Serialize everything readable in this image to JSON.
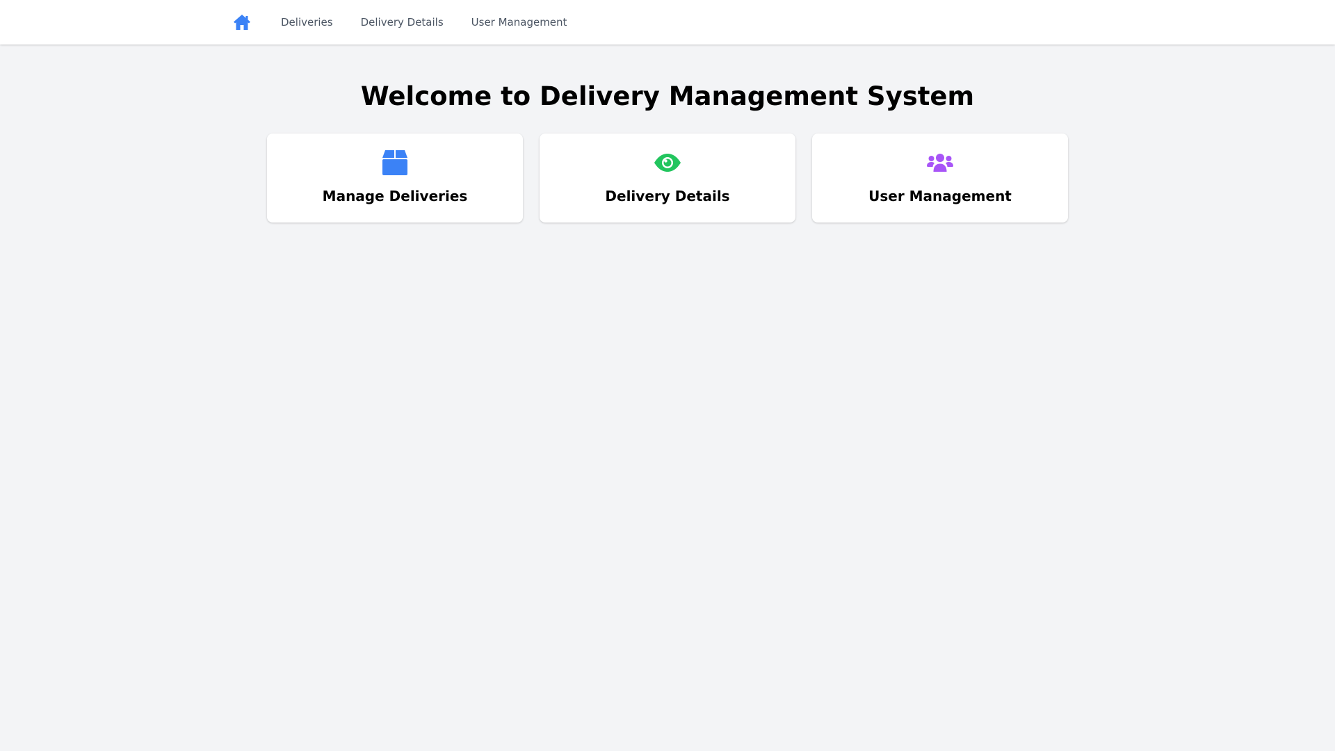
{
  "nav": {
    "home_icon": "home-icon",
    "links": [
      {
        "label": "Deliveries"
      },
      {
        "label": "Delivery Details"
      },
      {
        "label": "User Management"
      }
    ]
  },
  "main": {
    "title": "Welcome to Delivery Management System",
    "cards": [
      {
        "label": "Manage Deliveries",
        "icon": "box-icon",
        "color": "#3b82f6"
      },
      {
        "label": "Delivery Details",
        "icon": "eye-icon",
        "color": "#22c55e"
      },
      {
        "label": "User Management",
        "icon": "users-icon",
        "color": "#a855f7"
      }
    ]
  },
  "colors": {
    "accent": "#3b82f6",
    "background": "#f3f4f6",
    "nav_text": "#4b5563"
  }
}
